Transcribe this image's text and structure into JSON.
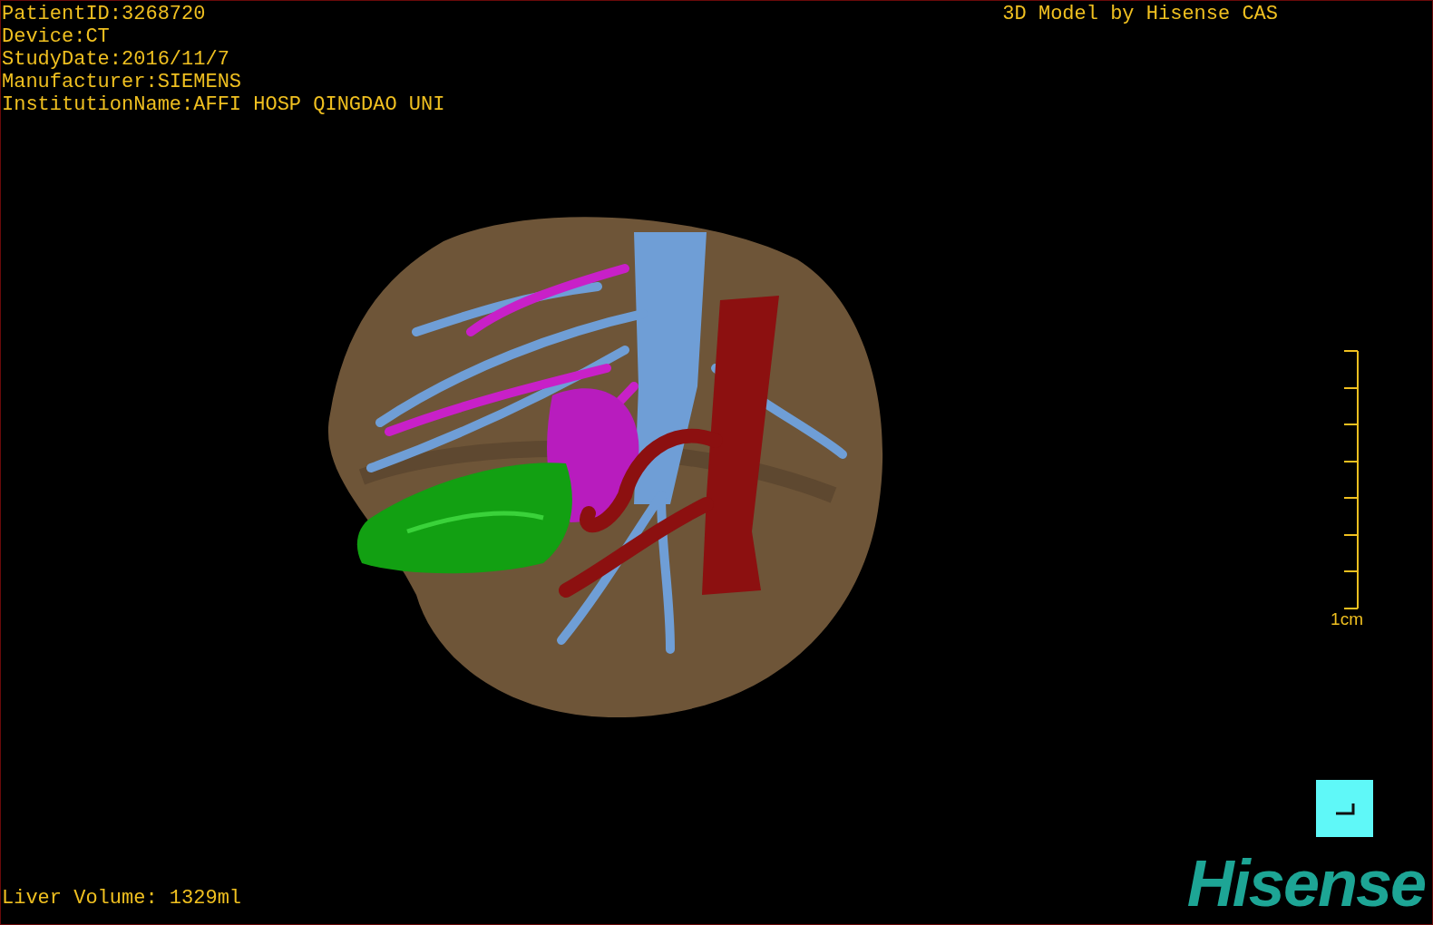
{
  "header": {
    "info_lines": [
      "PatientID:3268720",
      "Device:CT",
      "StudyDate:2016/11/7",
      "Manufacturer:SIEMENS",
      "InstitutionName:AFFI HOSP QINGDAO UNI"
    ],
    "title": "3D Model by Hisense CAS"
  },
  "scale_bar": {
    "label": "1cm"
  },
  "footer": {
    "liver_volume": "Liver Volume: 1329ml",
    "logo": "Hisense"
  }
}
